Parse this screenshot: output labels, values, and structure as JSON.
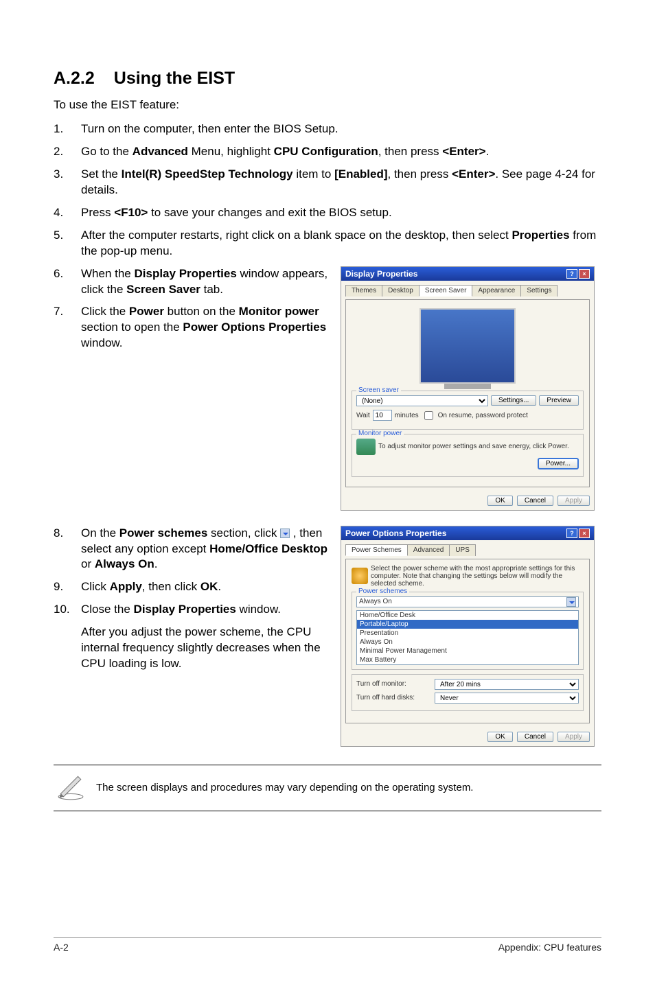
{
  "section": {
    "number": "A.2.2",
    "title": "Using the EIST"
  },
  "intro": "To use the EIST feature:",
  "steps": [
    {
      "n": "1.",
      "parts": [
        "Turn on the computer, then enter the BIOS Setup."
      ]
    },
    {
      "n": "2.",
      "parts": [
        "Go to the ",
        {
          "b": "Advanced"
        },
        " Menu, highlight ",
        {
          "b": "CPU Configuration"
        },
        ", then press ",
        {
          "b": "<Enter>"
        },
        "."
      ]
    },
    {
      "n": "3.",
      "parts": [
        "Set the ",
        {
          "b": "Intel(R) SpeedStep Technology"
        },
        " item to ",
        {
          "b": "[Enabled]"
        },
        ", then press ",
        {
          "b": "<Enter>"
        },
        ". See page 4-24 for details."
      ]
    },
    {
      "n": "4.",
      "parts": [
        "Press ",
        {
          "b": "<F10>"
        },
        " to save your changes and exit the BIOS setup."
      ]
    },
    {
      "n": "5.",
      "parts": [
        "After the computer restarts, right click on a blank space on the desktop, then select ",
        {
          "b": "Properties"
        },
        " from the pop-up menu."
      ]
    }
  ],
  "stepsCol1a": [
    {
      "n": "6.",
      "parts": [
        "When the ",
        {
          "b": "Display Properties"
        },
        " window appears, click the ",
        {
          "b": "Screen Saver"
        },
        " tab."
      ]
    },
    {
      "n": "7.",
      "parts": [
        "Click the ",
        {
          "b": "Power"
        },
        " button on the ",
        {
          "b": "Monitor power"
        },
        " section to open the ",
        {
          "b": "Power Options Properties"
        },
        " window."
      ]
    }
  ],
  "stepsCol1b": [
    {
      "n": "8.",
      "parts": [
        "On the ",
        {
          "b": "Power schemes"
        },
        " section, click ",
        {
          "icon": "dropdown"
        },
        " , then select any option except ",
        {
          "b": "Home/Office Desktop"
        },
        " or ",
        {
          "b": "Always On"
        },
        "."
      ]
    },
    {
      "n": "9.",
      "parts": [
        "Click ",
        {
          "b": "Apply"
        },
        ", then click ",
        {
          "b": "OK"
        },
        "."
      ]
    },
    {
      "n": "10.",
      "parts": [
        "Close the ",
        {
          "b": "Display Properties"
        },
        " window."
      ]
    },
    {
      "n": "",
      "parts": [
        "After you adjust the power scheme, the CPU internal frequency slightly decreases when the CPU loading is low."
      ]
    }
  ],
  "fig1": {
    "title": "Display Properties",
    "tabs": [
      "Themes",
      "Desktop",
      "Screen Saver",
      "Appearance",
      "Settings"
    ],
    "activeTab": 2,
    "group1": {
      "legend": "Screen saver",
      "select": "(None)",
      "btn1": "Settings...",
      "btn2": "Preview",
      "wait": "Wait",
      "min": "10",
      "check": "On resume, password protect"
    },
    "group2": {
      "legend": "Monitor power",
      "text": "To adjust monitor power settings and save energy, click Power.",
      "btn": "Power..."
    },
    "ok": "OK",
    "cancel": "Cancel",
    "apply": "Apply"
  },
  "fig2": {
    "title": "Power Options Properties",
    "tabs": [
      "Power Schemes",
      "Advanced",
      "UPS"
    ],
    "activeTab": 0,
    "desc": "Select the power scheme with the most appropriate settings for this computer. Note that changing the settings below will modify the selected scheme.",
    "group1": {
      "legend": "Power schemes",
      "value": "Always On",
      "options": [
        "Home/Office Desk",
        "Portable/Laptop",
        "Presentation",
        "Always On",
        "Minimal Power Management",
        "Max Battery"
      ]
    },
    "group2": {
      "legend": "Turn off monitor:",
      "v1": "After 20 mins",
      "legend2": "Turn off hard disks:",
      "v2": "Never"
    },
    "ok": "OK",
    "cancel": "Cancel",
    "apply": "Apply"
  },
  "note": "The screen displays and procedures may vary depending on the operating system.",
  "footer": {
    "left": "A-2",
    "right": "Appendix: CPU features"
  }
}
